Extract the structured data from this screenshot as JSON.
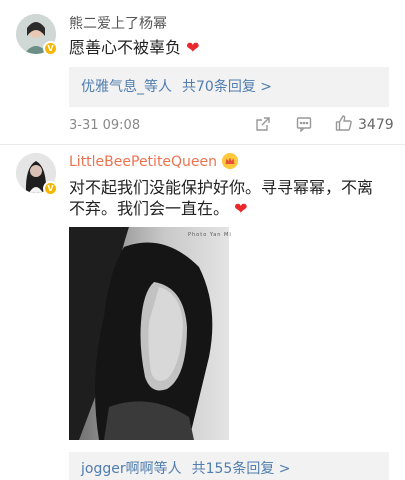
{
  "comments": [
    {
      "username": "熊二爱上了杨幂",
      "text": "愿善心不被辜负",
      "heart": "❤️",
      "reply": {
        "users": "优雅气息_等人",
        "count": "共70条回复 >"
      },
      "timestamp": "3-31 09:08",
      "likes": "3479"
    },
    {
      "username": "LittleBeePetiteQueen",
      "text_line1": "对不起我们没能保护好你。寻寻幂幂，不离",
      "text_line2": "不弃。我们会一直在。",
      "heart": "❤️",
      "image_caption": "Photo Yan Mi",
      "reply": {
        "users": "jogger啊啊等人",
        "count": "共155条回复 >"
      }
    }
  ],
  "badge": "V",
  "colors": {
    "link": "#507daf",
    "vip_name": "#eb7350",
    "reply_bg": "#f2f2f2",
    "heart": "#e8282b"
  }
}
